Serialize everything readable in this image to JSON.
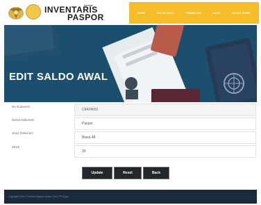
{
  "header": {
    "brand_small": "SISTEM",
    "brand_line1": "INVENTARIS",
    "brand_line2": "PASPOR",
    "nav": [
      "HOME",
      "SALDO AWAL",
      "PEMBELIAN",
      "CATAT",
      "SALDO AKHIR"
    ]
  },
  "hero": {
    "title": "EDIT SALDO AWAL"
  },
  "form": {
    "fields": [
      {
        "label": "No Dokumen",
        "value": "C9424010"
      },
      {
        "label": "Nama Dokumen",
        "value": "Paspor"
      },
      {
        "label": "Jenis Dokumen",
        "value": "Biasa 48"
      },
      {
        "label": "Stock",
        "value": "30"
      }
    ]
  },
  "buttons": {
    "update": "Update",
    "reset": "Reset",
    "back": "Back"
  },
  "footer": {
    "text": "Copyright 2022 © Kantor Imigrasi Kelas I Non TPI Bogor"
  },
  "colors": {
    "nav_bg": "#f6bd2a",
    "hero_bg": "#1c4e6e",
    "footer_bg": "#1c2b3c",
    "button_bg": "#23262b"
  }
}
